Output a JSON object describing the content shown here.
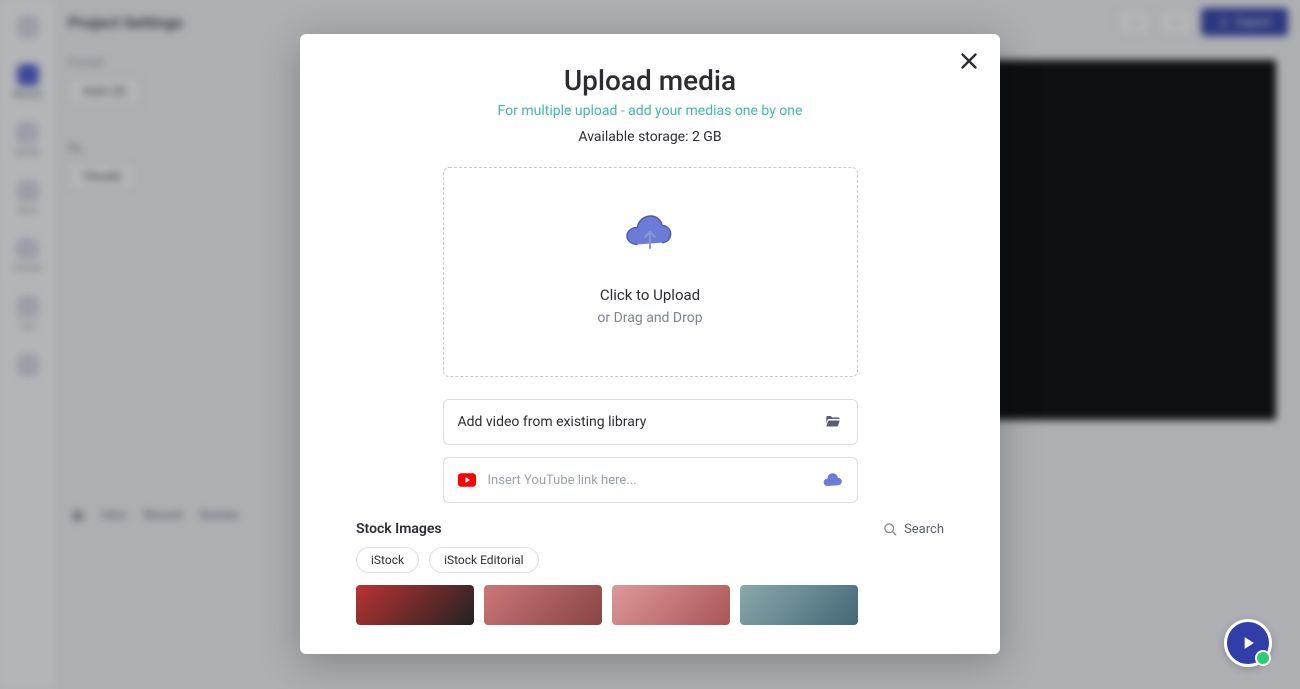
{
  "app": {
    "title": "Project Settings",
    "export_label": "Export"
  },
  "sidebar": {
    "items": [
      {
        "label": ""
      },
      {
        "label": "Record"
      },
      {
        "label": "Media"
      },
      {
        "label": "Story"
      },
      {
        "label": "Visuals"
      },
      {
        "label": "Text"
      },
      {
        "label": ""
      }
    ]
  },
  "left_panel": {
    "section1_label": "Format",
    "section1_value": "Auto (3)",
    "section2_label": "Bg",
    "section2_value": "Visuals"
  },
  "bottom": {
    "tabs": [
      "Intro",
      "Record",
      "Scenes"
    ]
  },
  "modal": {
    "title": "Upload media",
    "subtitle": "For multiple upload - add your medias one by one",
    "storage_prefix": "Available storage: ",
    "storage_value": "2 GB",
    "dropzone_line1": "Click to Upload",
    "dropzone_line2": "or Drag and Drop",
    "library_row_label": "Add video from existing library",
    "youtube_placeholder": "Insert YouTube link here...",
    "stock_heading": "Stock Images",
    "stock_search_label": "Search",
    "pills": [
      "iStock",
      "iStock Editorial"
    ]
  }
}
